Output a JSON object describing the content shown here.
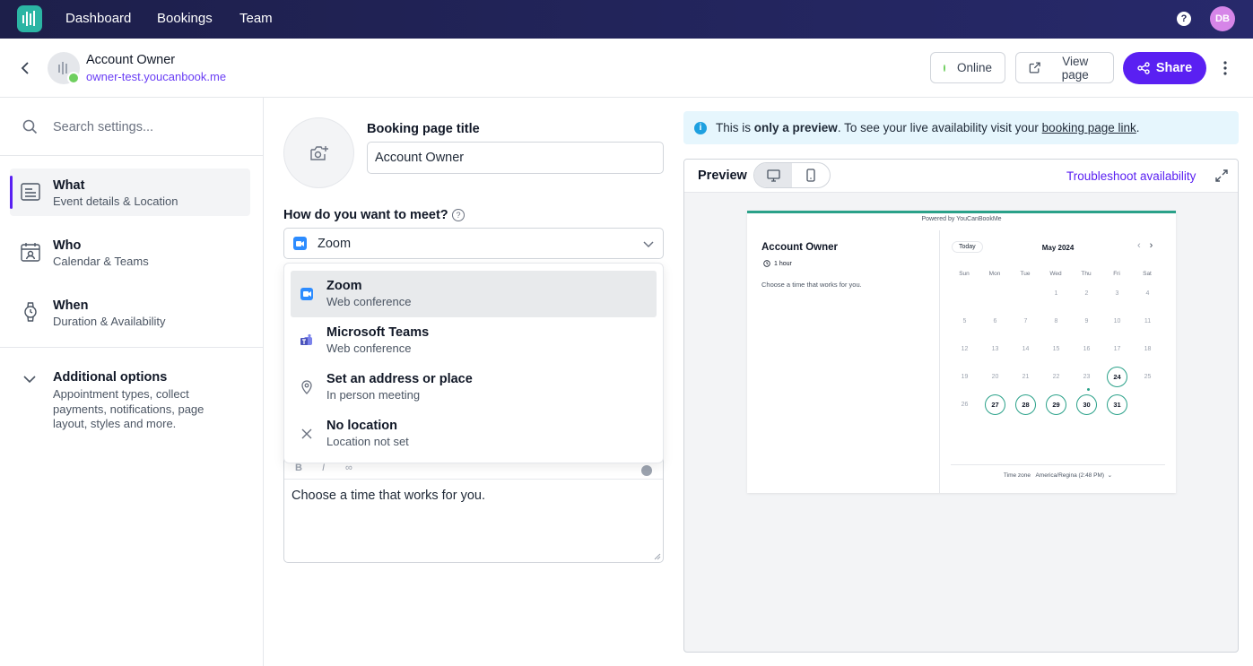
{
  "nav": {
    "links": [
      "Dashboard",
      "Bookings",
      "Team"
    ],
    "avatar_initials": "DB"
  },
  "account": {
    "name": "Account Owner",
    "url": "owner-test.youcanbook.me"
  },
  "header": {
    "status_label": "Online",
    "view_page_label": "View page",
    "share_label": "Share"
  },
  "sidebar": {
    "search_placeholder": "Search settings...",
    "items": [
      {
        "title": "What",
        "subtitle": "Event details & Location"
      },
      {
        "title": "Who",
        "subtitle": "Calendar & Teams"
      },
      {
        "title": "When",
        "subtitle": "Duration & Availability"
      }
    ],
    "additional": {
      "title": "Additional options",
      "subtitle": "Appointment types, collect payments, notifications, page layout, styles and more."
    }
  },
  "form": {
    "title_label": "Booking page title",
    "title_value": "Account Owner",
    "meet_label": "How do you want to meet?",
    "meet_value": "Zoom",
    "options": [
      {
        "title": "Zoom",
        "subtitle": "Web conference"
      },
      {
        "title": "Microsoft Teams",
        "subtitle": "Web conference"
      },
      {
        "title": "Set an address or place",
        "subtitle": "In person meeting"
      },
      {
        "title": "No location",
        "subtitle": "Location not set"
      }
    ],
    "description": "Choose a time that works for you."
  },
  "preview": {
    "notice_pre": "This is ",
    "notice_bold": "only a preview",
    "notice_mid": ". To see your live availability visit your ",
    "notice_link": "booking page link",
    "notice_end": ".",
    "title": "Preview",
    "troubleshoot": "Troubleshoot availability",
    "powered": "Powered by YouCanBookMe",
    "name": "Account Owner",
    "duration": "1 hour",
    "description": "Choose a time that works for you.",
    "today": "Today",
    "month": "May 2024",
    "weekdays": [
      "Sun",
      "Mon",
      "Tue",
      "Wed",
      "Thu",
      "Fri",
      "Sat"
    ],
    "days": [
      "1",
      "2",
      "3",
      "4",
      "5",
      "6",
      "7",
      "8",
      "9",
      "10",
      "11",
      "12",
      "13",
      "14",
      "15",
      "16",
      "17",
      "18",
      "19",
      "20",
      "21",
      "22",
      "23",
      "24",
      "25",
      "26",
      "27",
      "28",
      "29",
      "30",
      "31"
    ],
    "available_days": [
      "24",
      "27",
      "28",
      "29",
      "30",
      "31"
    ],
    "timezone_label": "Time zone",
    "timezone_value": "America/Regina (2:48 PM)"
  },
  "colors": {
    "accent": "#5a20f2",
    "brand_teal": "#2aa189",
    "online": "#6fcf5f"
  }
}
